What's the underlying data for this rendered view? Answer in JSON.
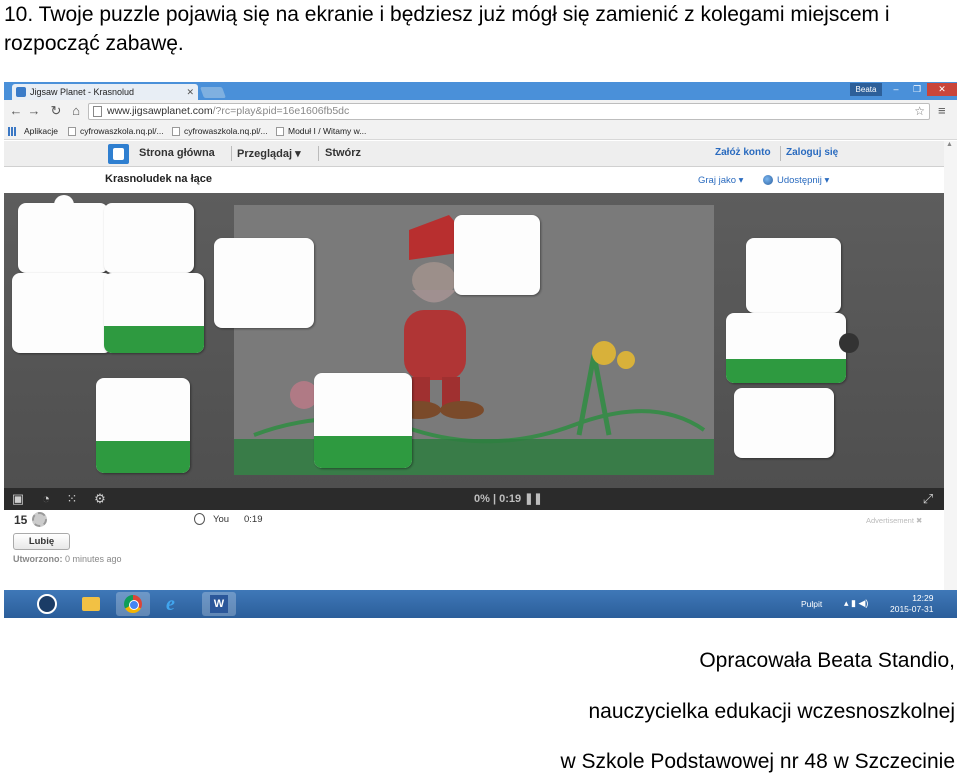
{
  "instruction": "10. Twoje puzzle pojawią się na ekranie i będziesz już mógł się zamienić z kolegami miejscem i rozpocząć zabawę.",
  "browser": {
    "tab_title": "Jigsaw Planet - Krasnolud",
    "user": "Beata",
    "url_host": "www.jigsawplanet.com",
    "url_path": "/?rc=play&pid=16e1606fb5dc",
    "bookmarks": [
      "Aplikacje",
      "cyfrowaszkola.nq.pl/...",
      "cyfrowaszkola.nq.pl/...",
      "Moduł I / Witamy w..."
    ]
  },
  "site": {
    "nav_home": "Strona główna",
    "nav_browse": "Przeglądaj ▾",
    "nav_create": "Stwórz",
    "signup": "Załóż konto",
    "login": "Zaloguj się",
    "puzzle_title": "Krasnoludek na łące",
    "play_as": "Graj jako ▾",
    "share": "Udostępnij ▾"
  },
  "game": {
    "progress": "0%",
    "time": "0:19",
    "progress_fraction": 0
  },
  "info": {
    "count": "15",
    "you_label": "You",
    "you_time": "0:19",
    "advertisement": "Advertisement",
    "like": "Lubię",
    "created_label": "Utworzono:",
    "created_value": "0 minutes ago"
  },
  "taskbar": {
    "desktop": "Pulpit",
    "time": "12:29",
    "date": "2015-07-31"
  },
  "footer": {
    "line1": "Opracowała Beata Standio,",
    "line2": "nauczycielka edukacji wczesnoszkolnej",
    "line3": "w Szkole Podstawowej nr 48 w Szczecinie"
  },
  "colors": {
    "taskbar": "#2b5e9a",
    "board": "#555555",
    "link": "#2a6bbf",
    "grass": "#2e9a40"
  }
}
